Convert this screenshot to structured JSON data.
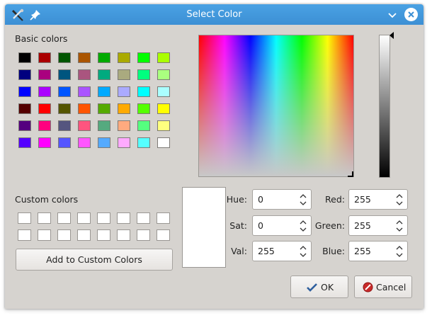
{
  "window": {
    "title": "Select Color"
  },
  "sections": {
    "basic_colors": "Basic colors",
    "custom_colors": "Custom colors"
  },
  "basic_colors": [
    [
      "#000000",
      "#aa0000",
      "#005500",
      "#aa5500",
      "#00aa00",
      "#aaaa00",
      "#00ff00",
      "#aaff00"
    ],
    [
      "#00007f",
      "#aa007f",
      "#00557f",
      "#aa557f",
      "#00aa7f",
      "#aaaa7f",
      "#00ff7f",
      "#aaff7f"
    ],
    [
      "#0000ff",
      "#aa00ff",
      "#0055ff",
      "#aa55ff",
      "#00aaff",
      "#aaaaff",
      "#00ffff",
      "#aaffff"
    ],
    [
      "#550000",
      "#ff0000",
      "#555500",
      "#ff5500",
      "#55aa00",
      "#ffaa00",
      "#55ff00",
      "#ffff00"
    ],
    [
      "#55007f",
      "#ff007f",
      "#55557f",
      "#ff557f",
      "#55aa7f",
      "#ffaa7f",
      "#55ff7f",
      "#ffff7f"
    ],
    [
      "#5500ff",
      "#ff00ff",
      "#5555ff",
      "#ff55ff",
      "#55aaff",
      "#ffaaff",
      "#55ffff",
      "#ffffff"
    ]
  ],
  "custom_colors": [
    [
      "#ffffff",
      "#ffffff",
      "#ffffff",
      "#ffffff",
      "#ffffff",
      "#ffffff",
      "#ffffff",
      "#ffffff"
    ],
    [
      "#ffffff",
      "#ffffff",
      "#ffffff",
      "#ffffff",
      "#ffffff",
      "#ffffff",
      "#ffffff",
      "#ffffff"
    ]
  ],
  "add_custom_label": "Add to Custom Colors",
  "fields": {
    "hue": {
      "label": "Hue:",
      "value": "0"
    },
    "sat": {
      "label": "Sat:",
      "value": "0"
    },
    "val": {
      "label": "Val:",
      "value": "255"
    },
    "red": {
      "label": "Red:",
      "value": "255"
    },
    "green": {
      "label": "Green:",
      "value": "255"
    },
    "blue": {
      "label": "Blue:",
      "value": "255"
    }
  },
  "current_color": "#ffffff",
  "buttons": {
    "ok": "OK",
    "cancel": "Cancel"
  },
  "colors": {
    "titlebar": "#3c8fd4",
    "dialog_bg": "#d6d3cf"
  }
}
